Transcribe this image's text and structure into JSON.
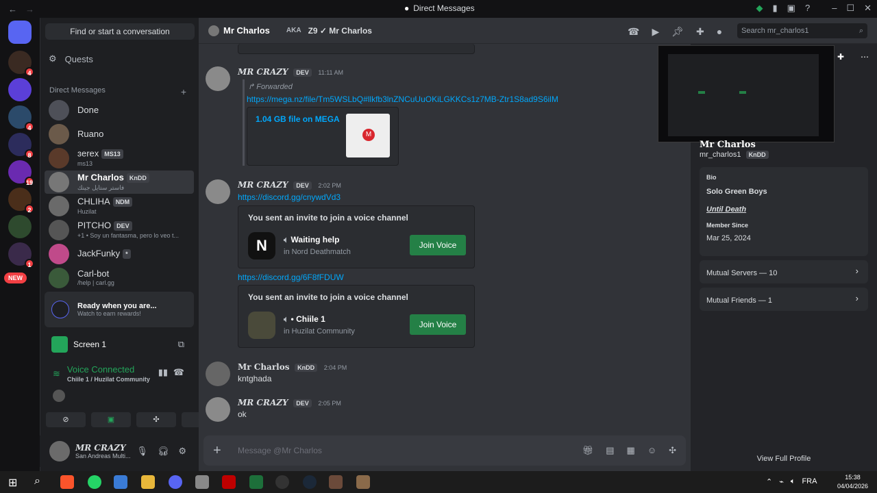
{
  "window": {
    "title": "Direct Messages"
  },
  "left_panel": {
    "find_placeholder": "Find or start a conversation",
    "quests": "Quests",
    "dm_header": "Direct Messages",
    "server_badges": [
      "4",
      "4",
      "8",
      "19",
      "2",
      "1"
    ],
    "new_badge": "NEW",
    "dms": [
      {
        "name": "Done",
        "sub": "",
        "tag": ""
      },
      {
        "name": "Ruano",
        "sub": "",
        "tag": ""
      },
      {
        "name": "ɜerex",
        "sub": "ms13",
        "tag": "MS13"
      },
      {
        "name": "Mr Charlos",
        "sub": "فاستر ستايل جينك",
        "tag": "KnDD"
      },
      {
        "name": "CHLIHA",
        "sub": "Huzilat",
        "tag": "NDM"
      },
      {
        "name": "PITCHO",
        "sub": "+1 • Soy un fantasma, pero lo veo t...",
        "tag": "DEV"
      },
      {
        "name": "JackFunky",
        "sub": "",
        "tag": "*"
      },
      {
        "name": "Carl-bot",
        "sub": "/help | carl.gg",
        "tag": ""
      }
    ],
    "ready_title": "Ready when you are...",
    "ready_sub": "Watch to earn rewards!",
    "screen": "Screen 1",
    "voice_status": "Voice Connected",
    "voice_channel": "Chiile 1 / Huzilat Community",
    "user_name": "MR CRAZY",
    "user_status": "San Andreas Multi..."
  },
  "header": {
    "name": "Mr Charlos",
    "aka": "AKA",
    "alias": "Z9 ✓ Mr Charlos",
    "search_placeholder": "Search mr_charlos1"
  },
  "messages": {
    "m1": {
      "author": "MR CRAZY",
      "tag": "DEV",
      "time": "11:11 AM",
      "forwarded": "Forwarded",
      "link": "https://mega.nz/file/Tm5WSLbQ#llkfb3lnZNCuUuOKiLGKKCs1z7MB-Ztr1S8ad9S6ilM",
      "embed": "1.04 GB file on MEGA"
    },
    "m2": {
      "author": "MR CRAZY",
      "tag": "DEV",
      "time": "2:02 PM",
      "link": "https://discord.gg/cnywdVd3",
      "invite_title": "You sent an invite to join a voice channel",
      "channel": "Waiting help",
      "server": "in Nord Deathmatch",
      "join": "Join Voice"
    },
    "m3": {
      "link": "https://discord.gg/6F8fFDUW",
      "invite_title": "You sent an invite to join a voice channel",
      "channel": "• Chiile 1",
      "server": "in Huzilat Community",
      "join": "Join Voice"
    },
    "m4": {
      "author": "Mr Charlos",
      "tag": "KnDD",
      "time": "2:04 PM",
      "text": "kntghada"
    },
    "m5": {
      "author": "MR CRAZY",
      "tag": "DEV",
      "time": "2:05 PM",
      "text": "ok"
    }
  },
  "composer": {
    "placeholder": "Message @Mr Charlos"
  },
  "profile": {
    "display_name": "Mr Charlos",
    "username": "mr_charlos1",
    "tag": "KnDD",
    "bio_label": "Bio",
    "bio_line1": "Solo Green Boys",
    "bio_line2": "Until Death",
    "member_since_label": "Member Since",
    "member_since": "Mar 25, 2024",
    "mutual_servers": "Mutual Servers — 10",
    "mutual_friends": "Mutual Friends — 1",
    "view_full": "View Full Profile"
  },
  "taskbar": {
    "time": "15:38",
    "date": "04/04/2026",
    "lang": "FRA"
  },
  "colors": {
    "accent": "#5865f2",
    "join": "#248046",
    "link": "#00a8fc",
    "badge": "#f23f43"
  }
}
